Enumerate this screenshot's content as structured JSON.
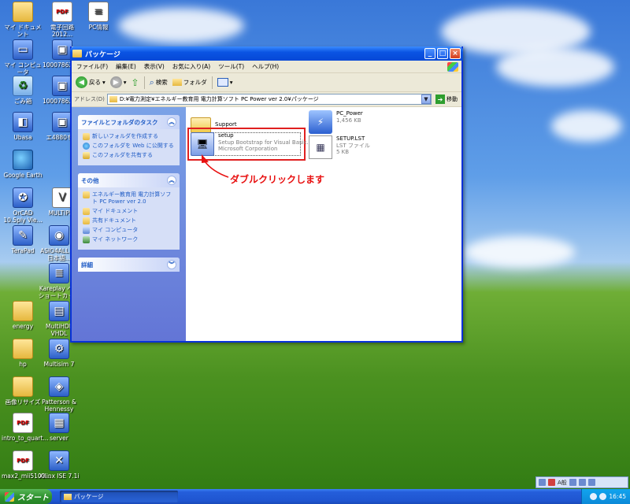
{
  "desktop": {
    "icons": [
      {
        "label": "マイ ドキュメント",
        "glyph": "folder"
      },
      {
        "label": "電子回路2012...",
        "glyph": "pdf"
      },
      {
        "label": "PC情報",
        "glyph": "doc"
      },
      {
        "label": "マイ コンピュータ",
        "glyph": "computer"
      },
      {
        "label": "100078622...",
        "glyph": "app"
      },
      {
        "label": "ごみ箱",
        "glyph": "recycle"
      },
      {
        "label": "100078622...",
        "glyph": "app"
      },
      {
        "label": "Ubasa",
        "glyph": "app"
      },
      {
        "label": "エ4880を...",
        "glyph": "app"
      },
      {
        "label": "Google Earth",
        "glyph": "earth"
      },
      {
        "label": "OrCAD 10.5ply Vie...",
        "glyph": "app"
      },
      {
        "label": "MULTIPLE",
        "glyph": "doc"
      },
      {
        "label": "TeraPad",
        "glyph": "app"
      },
      {
        "label": "ASIO4ALL v2 日本語...",
        "glyph": "app"
      },
      {
        "label": "Kareplay へのショートカット",
        "glyph": "app"
      },
      {
        "label": "energy",
        "glyph": "folder"
      },
      {
        "label": "MultiHDL VHDL",
        "glyph": "app"
      },
      {
        "label": "hp",
        "glyph": "folder"
      },
      {
        "label": "Multisim 7",
        "glyph": "app"
      },
      {
        "label": "画像リサイズ",
        "glyph": "folder"
      },
      {
        "label": "Patterson & Hennessy",
        "glyph": "app"
      },
      {
        "label": "intro_to_quart...",
        "glyph": "pdf"
      },
      {
        "label": "server",
        "glyph": "app"
      },
      {
        "label": "max2_mii5100...",
        "glyph": "pdf"
      },
      {
        "label": "Xilinx ISE 7.1i",
        "glyph": "app"
      }
    ]
  },
  "window": {
    "title": "パッケージ",
    "menu": [
      "ファイル(F)",
      "編集(E)",
      "表示(V)",
      "お気に入り(A)",
      "ツール(T)",
      "ヘルプ(H)"
    ],
    "toolbar": {
      "back": "戻る",
      "search": "検索",
      "folders": "フォルダ"
    },
    "address": {
      "label": "アドレス(D)",
      "path": "D:¥電力測定¥エネルギー教育用 電力計算ソフト PC Power ver 2.0¥パッケージ",
      "go": "移動"
    },
    "taskpane": {
      "file_tasks": {
        "title": "ファイルとフォルダのタスク",
        "items": [
          "新しいフォルダを作成する",
          "このフォルダを Web に公開する",
          "このフォルダを共有する"
        ]
      },
      "other": {
        "title": "その他",
        "items": [
          "エネルギー教育用 電力計算ソフト PC Power ver 2.0",
          "マイ ドキュメント",
          "共有ドキュメント",
          "マイ コンピュータ",
          "マイ ネットワーク"
        ]
      },
      "details": {
        "title": "詳細"
      }
    },
    "files": [
      {
        "name": "Support",
        "line2": "",
        "line3": "",
        "icon": "folder-icon"
      },
      {
        "name": "PC_Power",
        "line2": "1,456 KB",
        "line3": "",
        "icon": "pc-power-icon"
      },
      {
        "name": "setup",
        "line2": "Setup Bootstrap for Visual Basic...",
        "line3": "Microsoft Corporation",
        "icon": "setup-icon"
      },
      {
        "name": "SETUP.LST",
        "line2": "LST ファイル",
        "line3": "5 KB",
        "icon": "lst-file-icon"
      }
    ]
  },
  "annotation": "ダブルクリックします",
  "taskbar": {
    "start": "スタート",
    "task": "パッケージ",
    "clock": "16:45",
    "ime": "A般"
  },
  "colors": {
    "annotation": "#e81010",
    "titlebar": "#0a54e3",
    "taskpane": "#6375d6"
  }
}
